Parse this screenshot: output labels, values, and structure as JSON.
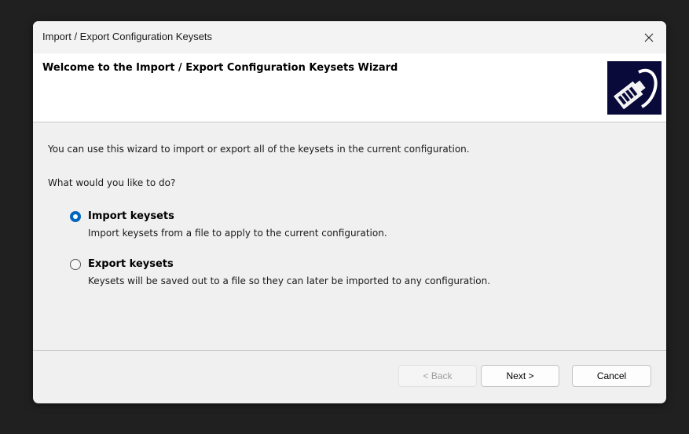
{
  "window": {
    "title": "Import / Export Configuration Keysets"
  },
  "header": {
    "title": "Welcome to the Import / Export Configuration Keysets Wizard"
  },
  "content": {
    "intro": "You can use this wizard to import or export all of the keysets in the current configuration.",
    "question": "What would you like to do?",
    "options": [
      {
        "label": "Import keysets",
        "description": "Import keysets from a file to apply to the current configuration.",
        "selected": true
      },
      {
        "label": "Export keysets",
        "description": "Keysets will be saved out to a file so they can later be imported to any configuration.",
        "selected": false
      }
    ]
  },
  "buttons": {
    "back": "< Back",
    "next": "Next >",
    "cancel": "Cancel"
  },
  "colors": {
    "accent": "#0067c0",
    "header_icon_bg": "#0a0a3a"
  }
}
